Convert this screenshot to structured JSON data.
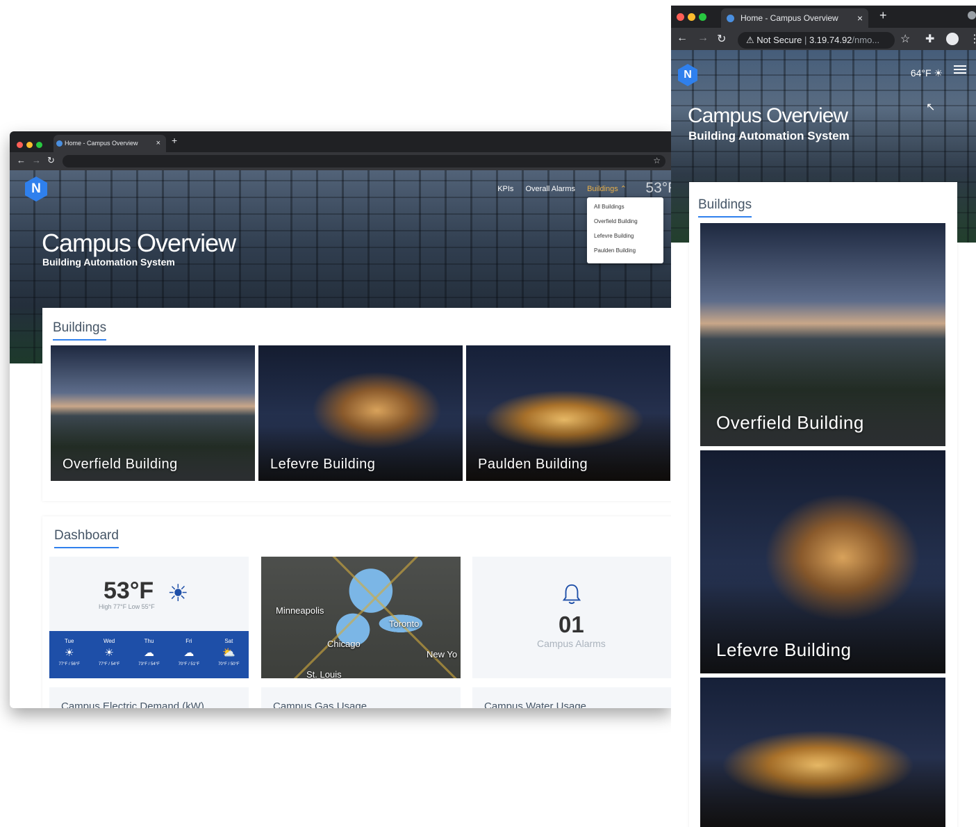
{
  "desktop": {
    "tab_title": "Home - Campus Overview",
    "new_tab": "+",
    "tab_close": "×",
    "hero": {
      "title": "Campus Overview",
      "subtitle": "Building Automation System"
    },
    "nav": {
      "kpis": "KPIs",
      "alarms": "Overall Alarms",
      "buildings": "Buildings ⌃",
      "temp": "53°F"
    },
    "dropdown": [
      "All Buildings",
      "Overfield Building",
      "Lefevre Building",
      "Paulden Building"
    ],
    "buildings_title": "Buildings",
    "buildings": [
      "Overfield Building",
      "Lefevre Building",
      "Paulden Building"
    ],
    "dashboard_title": "Dashboard",
    "weather": {
      "temp": "53°F",
      "hilo": "High 77°F Low 55°F",
      "forecast": [
        {
          "day": "Tue",
          "icon": "sun-icon",
          "glyph": "☀",
          "range": "77°F / 56°F"
        },
        {
          "day": "Wed",
          "icon": "sun-icon",
          "glyph": "☀",
          "range": "77°F / 54°F"
        },
        {
          "day": "Thu",
          "icon": "rain-icon",
          "glyph": "☁",
          "range": "73°F / 54°F"
        },
        {
          "day": "Fri",
          "icon": "rain-icon",
          "glyph": "☁",
          "range": "70°F / 51°F"
        },
        {
          "day": "Sat",
          "icon": "partly-cloudy-icon",
          "glyph": "⛅",
          "range": "70°F / 50°F"
        }
      ]
    },
    "map_cities": [
      "Minneapolis",
      "Toronto",
      "Chicago",
      "New Yo",
      "St. Louis"
    ],
    "alarms": {
      "count": "01",
      "label": "Campus Alarms"
    },
    "bottom_titles": [
      "Campus Electric Demand (kW)",
      "Campus Gas Usage",
      "Campus Water Usage"
    ]
  },
  "mobile": {
    "tab_title": "Home - Campus Overview",
    "tab_close": "×",
    "new_tab": "+",
    "address_security": "Not Secure",
    "address_host": "3.19.74.92",
    "address_path": "/nmo...",
    "temp": "64°F ☀",
    "hero": {
      "title": "Campus Overview",
      "subtitle": "Building Automation System"
    },
    "buildings_title": "Buildings",
    "buildings": [
      "Overfield Building",
      "Lefevre Building"
    ]
  },
  "colors": {
    "accent": "#2f80ed",
    "nav_active": "#e8b04a",
    "forecast_bg": "#1e4fa8"
  }
}
